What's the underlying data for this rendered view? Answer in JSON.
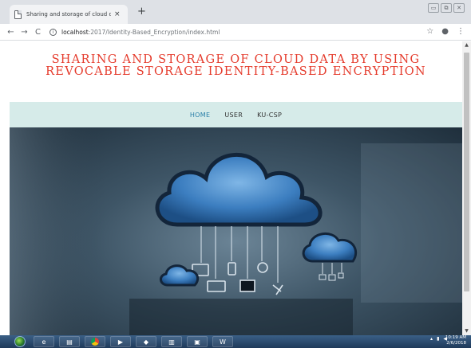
{
  "browser": {
    "tab_title": "Sharing and storage of cloud da",
    "tab_close": "×",
    "new_tab": "+",
    "window_controls": [
      "▭",
      "⧉",
      "✕"
    ],
    "back": "←",
    "forward": "→",
    "reload": "C",
    "url_host": "localhost",
    "url_rest": ":2017/Identity-Based_Encryption/index.html",
    "bookmark_icon": "star-icon",
    "account_icon": "account-icon",
    "menu_icon": "kebab-menu-icon"
  },
  "site": {
    "title": "SHARING AND STORAGE OF CLOUD DATA BY USING REVOCABLE STORAGE IDENTITY-BASED ENCRYPTION",
    "nav": [
      {
        "label": "HOME",
        "active": true
      },
      {
        "label": "USER",
        "active": false
      },
      {
        "label": "KU-CSP",
        "active": false
      }
    ],
    "hero_description_icons": [
      "cloud-icon",
      "monitor-icon",
      "phone-icon",
      "antenna-icon",
      "laptop-icon",
      "server-icon",
      "satellite-icon"
    ]
  },
  "colors": {
    "title": "#e53b2c",
    "nav_bg": "#d6ebe9",
    "nav_active": "#2a7fa8",
    "cloud_fill": "#3c7ec0",
    "cloud_outline": "#13253a"
  },
  "taskbar": {
    "apps": [
      "ie-icon",
      "explorer-icon",
      "chrome-icon",
      "media-player-icon",
      "app-icon",
      "book-icon",
      "winrar-icon",
      "word-icon"
    ],
    "clock_time": "10:19 AM",
    "clock_date": "2/6/2018"
  }
}
